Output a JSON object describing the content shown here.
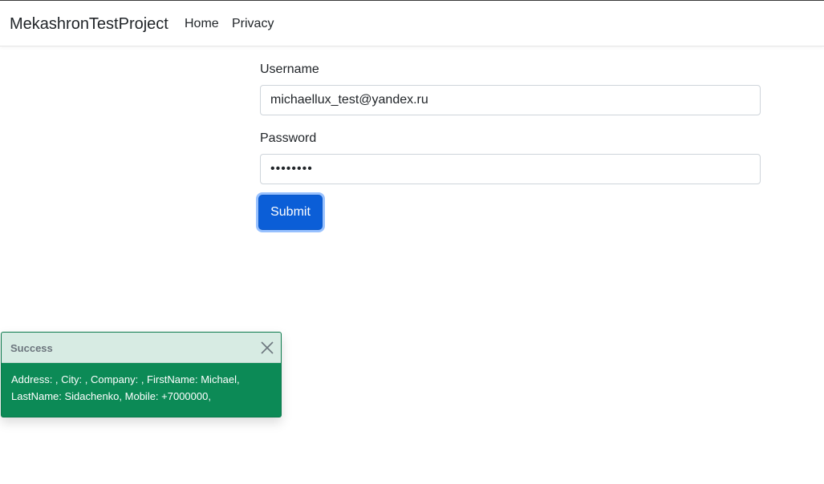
{
  "navbar": {
    "brand": "MekashronTestProject",
    "links": [
      {
        "label": "Home"
      },
      {
        "label": "Privacy"
      }
    ]
  },
  "login_form": {
    "username_label": "Username",
    "username_value": "michaellux_test@yandex.ru",
    "password_label": "Password",
    "password_value": "passw0rd",
    "submit_label": "Submit"
  },
  "toast": {
    "title": "Success",
    "message": "Address: , City: , Company: , FirstName: Michael, LastName: Sidachenko, Mobile: +7000000,",
    "header_color": "#d7ebe3",
    "body_color": "#0c8a56"
  },
  "colors": {
    "primary_button": "#0b5ed7"
  }
}
